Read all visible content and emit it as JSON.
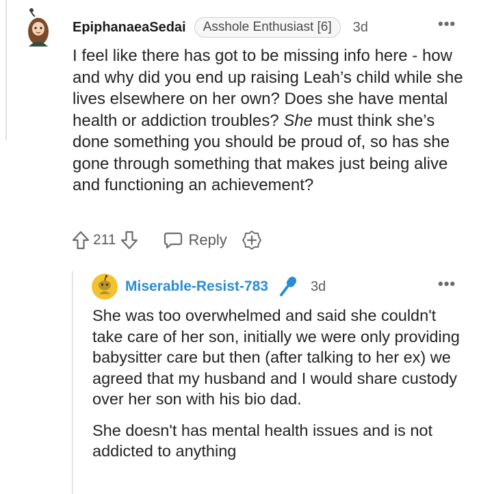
{
  "comment": {
    "author": "EpiphanaeaSedai",
    "flair": "Asshole Enthusiast [6]",
    "age": "3d",
    "body_before_italic": "I feel like there has got to be missing info here - how and why did you end up raising Leah’s child while she lives elsewhere on her own? Does she have mental health or addiction troubles? ",
    "body_italic": "She",
    "body_after_italic": " must think she’s done something you should be proud of, so has she gone through something that makes just being alive and functioning an achievement?",
    "score": "211",
    "reply_label": "Reply",
    "more_label": "•••"
  },
  "reply": {
    "author": "Miserable-Resist-783",
    "age": "3d",
    "paragraph_1": "She was too overwhelmed and said she couldn't take care of her son, initially we were only providing babysitter care but then (after talking to her ex) we agreed that my husband and I would share custody over her son with his bio dad.",
    "paragraph_2": "She doesn't has mental health issues and is not addicted to anything",
    "more_label": "•••"
  },
  "icons": {
    "upvote": "upvote-arrow-icon",
    "downvote": "downvote-arrow-icon",
    "reply": "speech-bubble-icon",
    "award": "award-plus-icon",
    "op_badge": "microphone-icon"
  },
  "colors": {
    "op_username": "#2a8dd4",
    "text": "#222222",
    "muted": "#5a5a5a"
  }
}
